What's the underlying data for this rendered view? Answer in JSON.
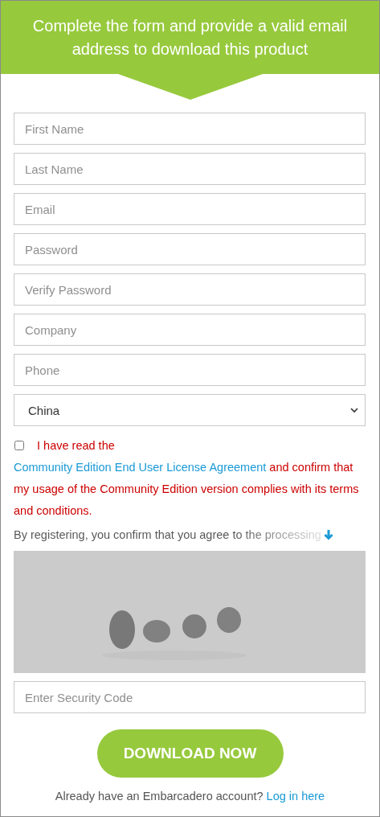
{
  "header": {
    "title": "Complete the form and provide a valid email address to download this product"
  },
  "fields": [
    {
      "kind": "text",
      "placeholder": "First Name"
    },
    {
      "kind": "text",
      "placeholder": "Last Name"
    },
    {
      "kind": "text",
      "placeholder": "Email"
    },
    {
      "kind": "password",
      "placeholder": "Password"
    },
    {
      "kind": "password",
      "placeholder": "Verify Password"
    },
    {
      "kind": "text",
      "placeholder": "Company"
    },
    {
      "kind": "text",
      "placeholder": "Phone"
    },
    {
      "kind": "select",
      "value": "China"
    }
  ],
  "agreement": {
    "checked": false,
    "parts": [
      {
        "kind": "text",
        "text": "I have read the "
      },
      {
        "kind": "link",
        "text": "Community Edition End User License Agreement"
      },
      {
        "kind": "text",
        "text": " and confirm that my usage of the Community Edition version complies with its terms and conditions."
      }
    ]
  },
  "consent": {
    "text": "By registering, you confirm that you agree to the processing"
  },
  "security_code": {
    "placeholder": "Enter Security Code"
  },
  "download_button": "DOWNLOAD NOW",
  "login": {
    "text": "Already have an Embarcadero account?",
    "link": "Log in here"
  }
}
